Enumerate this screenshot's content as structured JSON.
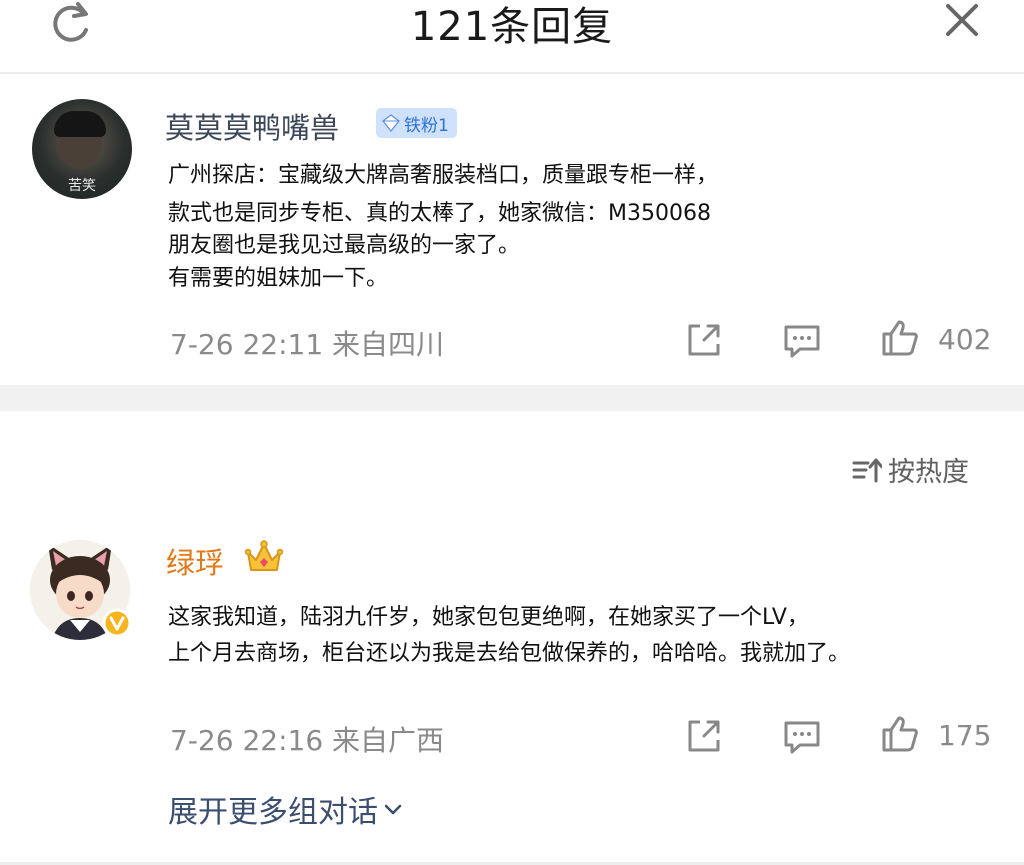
{
  "header": {
    "title": "121条回复",
    "refresh_icon": "refresh-icon",
    "close_icon": "close-icon"
  },
  "comment1": {
    "avatar_tag": "苦笑",
    "username": "莫莫莫鸭嘴兽",
    "badge": "铁粉1",
    "lines": [
      "广州探店：宝藏级大牌高奢服装档口，质量跟专柜一样，",
      "款式也是同步专柜、真的太棒了，她家微信：M350068",
      "朋友圈也是我见过最高级的一家了。",
      "有需要的姐妹加一下。"
    ],
    "time": "7-26 22:11",
    "location": "来自四川",
    "likes": "402"
  },
  "sort": {
    "label": "按热度"
  },
  "comment2": {
    "username": "绿琈",
    "lines": [
      "这家我知道，陆羽九仟岁，她家包包更绝啊，在她家买了一个LV，",
      "上个月去商场，柜台还以为我是去给包做保养的，哈哈哈。我就加了。"
    ],
    "time": "7-26 22:16",
    "location": "来自广西",
    "likes": "175"
  },
  "expand": {
    "label": "展开更多组对话"
  },
  "colors": {
    "username": "#3b4658",
    "username_vip": "#e07a1a",
    "meta": "#8a8a8a",
    "badge_bg": "#cfe2fb",
    "badge_text": "#2f72d6",
    "link": "#3b4e70"
  }
}
